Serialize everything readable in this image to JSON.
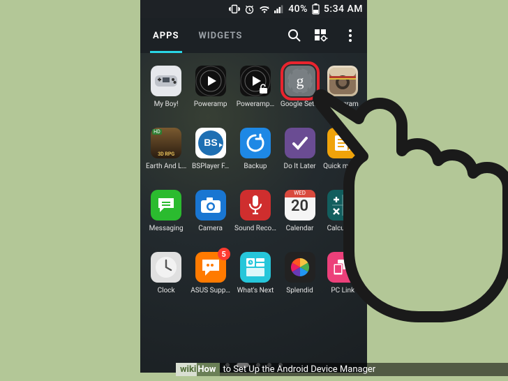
{
  "status": {
    "battery_pct": "40%",
    "time": "5:34 AM"
  },
  "tabs": {
    "apps": "APPS",
    "widgets": "WIDGETS"
  },
  "apps": {
    "r1": [
      {
        "label": "My Boy!"
      },
      {
        "label": "Poweramp"
      },
      {
        "label": "Poweramp…"
      },
      {
        "label": "Google Set…",
        "highlighted": true
      },
      {
        "label": "Instagram"
      }
    ],
    "r2": [
      {
        "label": "Earth And L…"
      },
      {
        "label": "BSPlayer F…"
      },
      {
        "label": "Backup"
      },
      {
        "label": "Do It Later"
      },
      {
        "label": "Quick memo"
      }
    ],
    "r3": [
      {
        "label": "Messaging"
      },
      {
        "label": "Camera"
      },
      {
        "label": "Sound Reco…"
      },
      {
        "label": "Calendar",
        "day": "20",
        "weekday": "WED"
      },
      {
        "label": "Calculator"
      }
    ],
    "r4": [
      {
        "label": "Clock"
      },
      {
        "label": "ASUS Supp…",
        "badge": "5"
      },
      {
        "label": "What's Next"
      },
      {
        "label": "Splendid"
      },
      {
        "label": "PC Link"
      }
    ]
  },
  "caption": {
    "brand_wiki": "wiki",
    "brand_how": "How",
    "title": " to Set Up the Android Device Manager"
  },
  "watermark": "wH"
}
